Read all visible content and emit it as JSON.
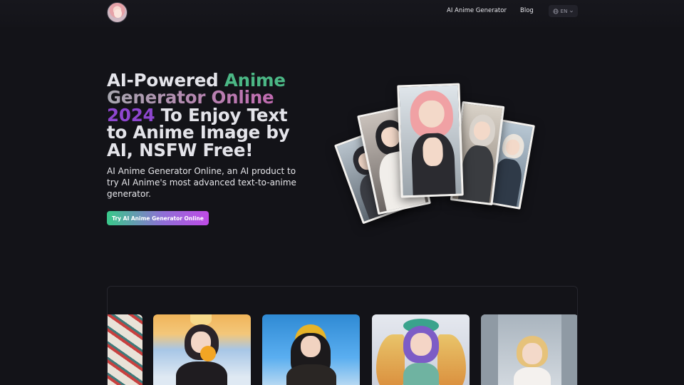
{
  "header": {
    "logo_alt": "AI Anime avatar",
    "nav": [
      {
        "label": "AI Anime Generator"
      },
      {
        "label": "Blog"
      }
    ],
    "language": {
      "label": "EN",
      "icon": "globe-icon",
      "caret_icon": "chevron-down-icon"
    }
  },
  "hero": {
    "title_lines": [
      {
        "parts": [
          "AI-Powered ",
          "Anime"
        ]
      },
      {
        "parts": [
          "Generator Online"
        ]
      },
      {
        "parts": [
          "2024",
          " To Enjoy Text"
        ]
      },
      {
        "parts": [
          "to Anime Image by"
        ]
      },
      {
        "parts": [
          "AI, NSFW Free!"
        ]
      }
    ],
    "subtitle": "AI Anime Generator Online, an AI product to try AI Anime's most advanced text-to-anime generator.",
    "cta_label": "Try AI Anime Generator Online"
  },
  "colors": {
    "background": "#131318",
    "accent_green": "#4bb785",
    "accent_pink": "#b154b0",
    "accent_purple": "#8e46cf"
  },
  "gallery": {
    "items": [
      {
        "name": "gallery-image-koi-art"
      },
      {
        "name": "gallery-image-sunflower-girl"
      },
      {
        "name": "gallery-image-hooded-girl"
      },
      {
        "name": "gallery-image-winged-girl"
      },
      {
        "name": "gallery-image-blonde-girl"
      }
    ]
  }
}
